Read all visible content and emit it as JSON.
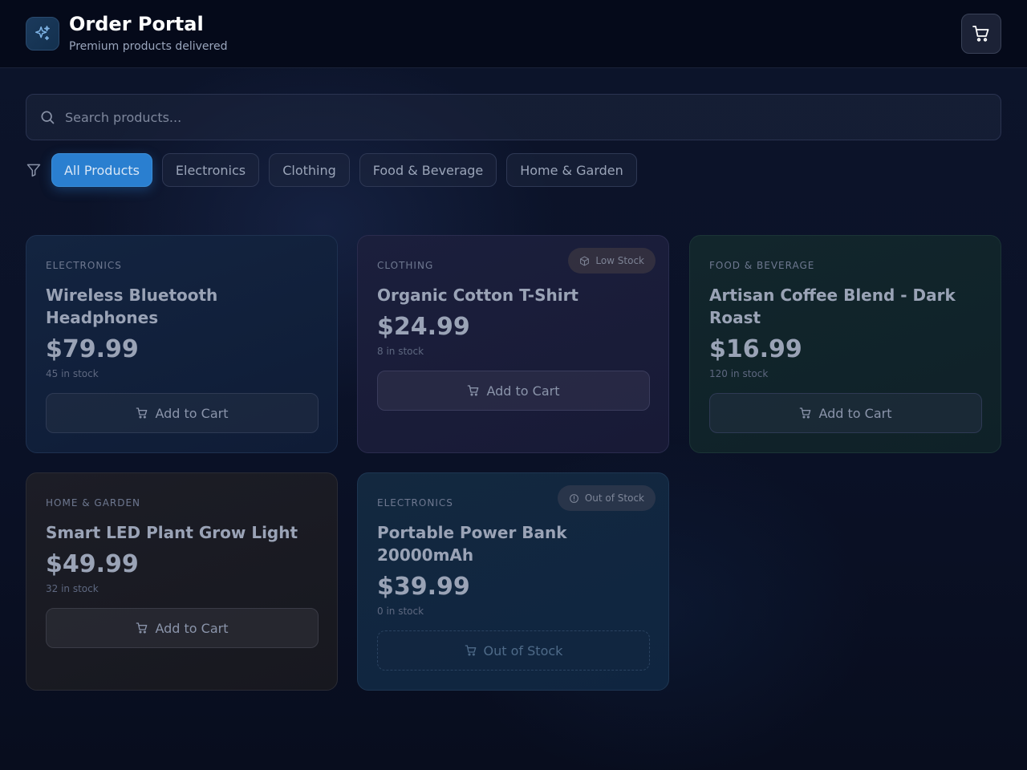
{
  "header": {
    "title": "Order Portal",
    "subtitle": "Premium products delivered",
    "logo_icon": "sparkles-icon",
    "cart_icon": "shopping-cart-icon"
  },
  "search": {
    "placeholder": "Search products..."
  },
  "filters": {
    "icon": "filter-icon",
    "chips": [
      "All Products",
      "Electronics",
      "Clothing",
      "Food & Beverage",
      "Home & Garden"
    ],
    "active": "All Products"
  },
  "products": [
    {
      "category": "ELECTRONICS",
      "name": "Wireless Bluetooth Headphones",
      "price": "$79.99",
      "stock": "45 in stock",
      "button": "Add to Cart",
      "badge": ""
    },
    {
      "category": "CLOTHING",
      "name": "Organic Cotton T-Shirt",
      "price": "$24.99",
      "stock": "8 in stock",
      "button": "Add to Cart",
      "badge": "Low Stock"
    },
    {
      "category": "FOOD & BEVERAGE",
      "name": "Artisan Coffee Blend - Dark Roast",
      "price": "$16.99",
      "stock": "120 in stock",
      "button": "Add to Cart",
      "badge": ""
    },
    {
      "category": "HOME & GARDEN",
      "name": "Smart LED Plant Grow Light",
      "price": "$49.99",
      "stock": "32 in stock",
      "button": "Add to Cart",
      "badge": ""
    },
    {
      "category": "ELECTRONICS",
      "name": "Portable Power Bank 20000mAh",
      "price": "$39.99",
      "stock": "0 in stock",
      "button": "Out of Stock",
      "badge": "Out of Stock"
    }
  ],
  "colors": {
    "accent": "#2a7fd0",
    "background": "#0a1022",
    "header": "#050a1a"
  }
}
